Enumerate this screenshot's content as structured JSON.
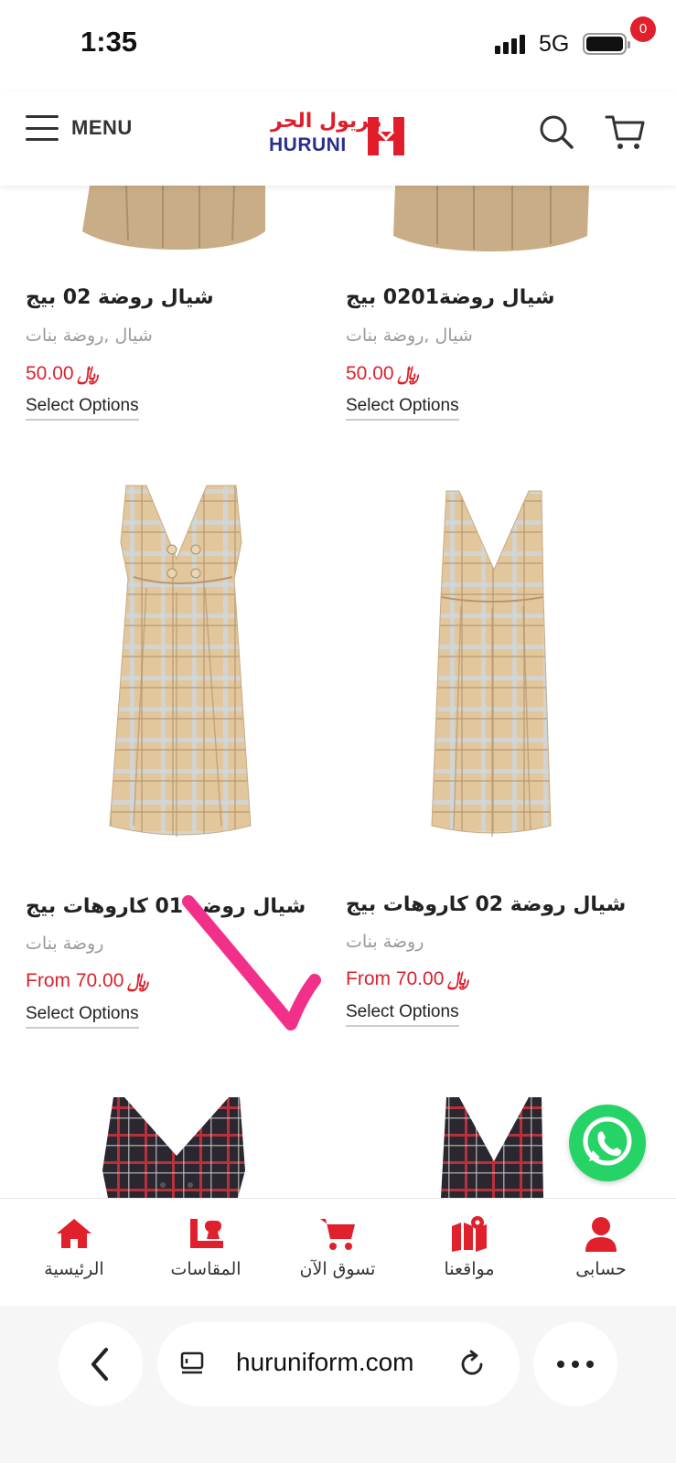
{
  "status": {
    "time": "1:35",
    "network": "5G"
  },
  "header": {
    "menu_label": "MENU",
    "logo_ar": "مريول الحر",
    "logo_en": "HURUNI",
    "cart_count": "0",
    "brand_color": "#e11d2b",
    "brand_secondary": "#2a2f8c"
  },
  "products": [
    {
      "title": "شيال روضة 02 بيج",
      "category": "شيال ,روضة بنات",
      "price": "50.00",
      "price_prefix": "",
      "button": "Select Options"
    },
    {
      "title": "شيال روضة0201 بيج",
      "category": "شيال ,روضة بنات",
      "price": "50.00",
      "price_prefix": "",
      "button": "Select Options"
    },
    {
      "title": "شيال روضة 01 كاروهات بيج",
      "category": "روضة بنات",
      "price": "70.00",
      "price_prefix": "From",
      "button": "Select Options"
    },
    {
      "title": "شيال روضة 02 كاروهات بيج",
      "category": "روضة بنات",
      "price": "70.00",
      "price_prefix": "From",
      "button": "Select Options"
    }
  ],
  "currency_symbol": "﷼",
  "bottom_nav": [
    {
      "label": "الرئيسية",
      "icon": "home-icon"
    },
    {
      "label": "المقاسات",
      "icon": "measurements-icon"
    },
    {
      "label": "تسوق الآن",
      "icon": "cart-icon"
    },
    {
      "label": "مواقعنا",
      "icon": "map-icon"
    },
    {
      "label": "حسابى",
      "icon": "user-icon"
    }
  ],
  "browser": {
    "url": "huruniform.com"
  },
  "colors": {
    "price": "#d8232f",
    "nav_icon": "#e0202c",
    "whatsapp": "#25d366"
  }
}
